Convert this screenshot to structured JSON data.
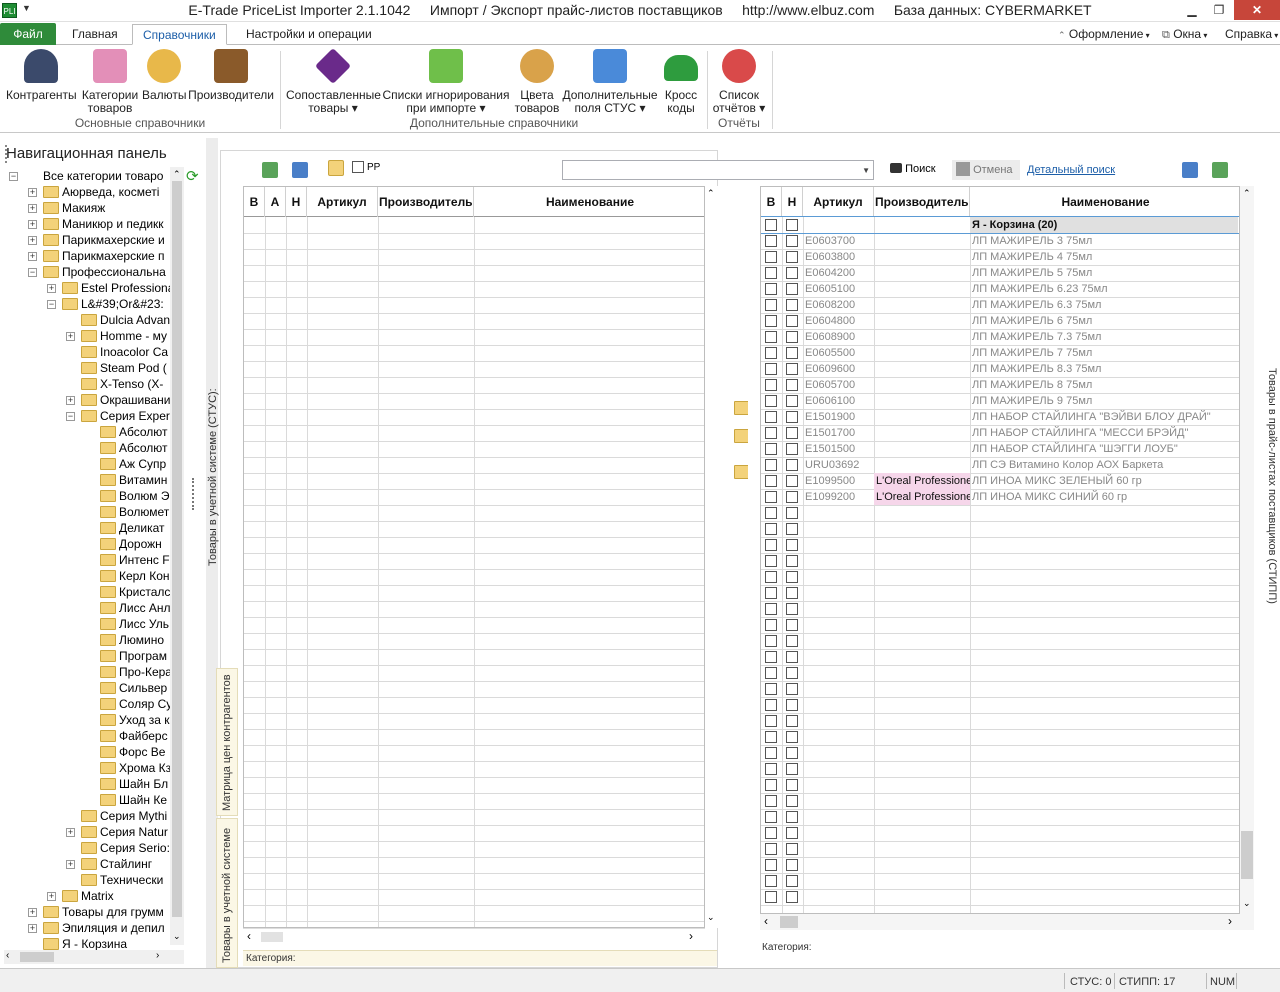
{
  "window": {
    "title": "E-Trade PriceList Importer 2.1.1042     Импорт / Экспорт прайс-листов поставщиков     http://www.elbuz.com     База данных: CYBERMARKET",
    "app_icon_text": "PLI",
    "controls": {
      "minimize": "▁",
      "maximize": "❐",
      "close": "✕"
    }
  },
  "ribbon_tabs": {
    "file": "Файл",
    "home": "Главная",
    "directories": "Справочники",
    "settings": "Настройки и операции",
    "right": {
      "design": "Оформление",
      "windows": "Окна",
      "help": "Справка"
    }
  },
  "ribbon": {
    "group1": {
      "label": "Основные справочники",
      "buttons": [
        {
          "line1": "Контрагенты",
          "line2": "",
          "icon": "contractor-icon",
          "color": "#3b4a6b"
        },
        {
          "line1": "Категории",
          "line2": "товаров",
          "icon": "categories-icon",
          "color": "#e38fb8"
        },
        {
          "line1": "Валюты",
          "line2": "",
          "icon": "currency-icon",
          "color": "#e8b84a"
        },
        {
          "line1": "Производители",
          "line2": "",
          "icon": "manufacturer-icon",
          "color": "#8a5a2a"
        }
      ]
    },
    "group2": {
      "label": "Дополнительные справочники",
      "buttons": [
        {
          "line1": "Сопоставленные",
          "line2": "товары ▾",
          "icon": "mapped-goods-icon",
          "color": "#6a2a8a"
        },
        {
          "line1": "Списки игнорирования",
          "line2": "при импорте ▾",
          "icon": "ignore-list-icon",
          "color": "#6fbf4a"
        },
        {
          "line1": "Цвета",
          "line2": "товаров",
          "icon": "colors-icon",
          "color": "#d9a24a"
        },
        {
          "line1": "Дополнительные",
          "line2": "поля СТУС ▾",
          "icon": "extra-fields-icon",
          "color": "#4a8ad9"
        },
        {
          "line1": "Кросс",
          "line2": "коды",
          "icon": "cross-codes-icon",
          "color": "#2e9c3e"
        }
      ]
    },
    "group3": {
      "label": "Отчёты",
      "buttons": [
        {
          "line1": "Список",
          "line2": "отчётов ▾",
          "icon": "reports-icon",
          "color": "#d94a4a"
        }
      ]
    }
  },
  "nav": {
    "title": "Навигационная панель",
    "tree": [
      {
        "level": 0,
        "exp": "−",
        "label": "Все категории товаро",
        "folder": false
      },
      {
        "level": 1,
        "exp": "+",
        "label": "Аюрведа, косметi"
      },
      {
        "level": 1,
        "exp": "+",
        "label": "Макияж"
      },
      {
        "level": 1,
        "exp": "+",
        "label": "Маникюр и педикк"
      },
      {
        "level": 1,
        "exp": "+",
        "label": "Парикмахерские и"
      },
      {
        "level": 1,
        "exp": "+",
        "label": "Парикмахерские п"
      },
      {
        "level": 1,
        "exp": "−",
        "label": "Профессиональна"
      },
      {
        "level": 2,
        "exp": "+",
        "label": "Estel Professiona"
      },
      {
        "level": 2,
        "exp": "−",
        "label": "L&#39;Or&#23:"
      },
      {
        "level": 3,
        "exp": "",
        "label": "Dulcia Advan"
      },
      {
        "level": 3,
        "exp": "+",
        "label": "Homme - му"
      },
      {
        "level": 3,
        "exp": "",
        "label": "Inoacolor Ca"
      },
      {
        "level": 3,
        "exp": "",
        "label": "Steam Pod ("
      },
      {
        "level": 3,
        "exp": "",
        "label": "X-Tenso (X-"
      },
      {
        "level": 3,
        "exp": "+",
        "label": "Окрашивани"
      },
      {
        "level": 3,
        "exp": "−",
        "label": "Серия Exper"
      },
      {
        "level": 4,
        "exp": "",
        "label": "Абсолют"
      },
      {
        "level": 4,
        "exp": "",
        "label": "Абсолют"
      },
      {
        "level": 4,
        "exp": "",
        "label": "Аж Супр"
      },
      {
        "level": 4,
        "exp": "",
        "label": "Витамин"
      },
      {
        "level": 4,
        "exp": "",
        "label": "Волюм Э"
      },
      {
        "level": 4,
        "exp": "",
        "label": "Волюмет"
      },
      {
        "level": 4,
        "exp": "",
        "label": "Деликат"
      },
      {
        "level": 4,
        "exp": "",
        "label": "Дорожн"
      },
      {
        "level": 4,
        "exp": "",
        "label": "Интенс F"
      },
      {
        "level": 4,
        "exp": "",
        "label": "Керл Кон"
      },
      {
        "level": 4,
        "exp": "",
        "label": "Кристалс"
      },
      {
        "level": 4,
        "exp": "",
        "label": "Лисс Анл"
      },
      {
        "level": 4,
        "exp": "",
        "label": "Лисс Уль"
      },
      {
        "level": 4,
        "exp": "",
        "label": "Люмино"
      },
      {
        "level": 4,
        "exp": "",
        "label": "Програм"
      },
      {
        "level": 4,
        "exp": "",
        "label": "Про-Кера"
      },
      {
        "level": 4,
        "exp": "",
        "label": "Сильвер"
      },
      {
        "level": 4,
        "exp": "",
        "label": "Соляр Су"
      },
      {
        "level": 4,
        "exp": "",
        "label": "Уход за к"
      },
      {
        "level": 4,
        "exp": "",
        "label": "Файберс"
      },
      {
        "level": 4,
        "exp": "",
        "label": "Форс Ве"
      },
      {
        "level": 4,
        "exp": "",
        "label": "Хрома Кз"
      },
      {
        "level": 4,
        "exp": "",
        "label": "Шайн Бл"
      },
      {
        "level": 4,
        "exp": "",
        "label": "Шайн Ке"
      },
      {
        "level": 3,
        "exp": "",
        "label": "Серия Mythi"
      },
      {
        "level": 3,
        "exp": "+",
        "label": "Серия Natur"
      },
      {
        "level": 3,
        "exp": "",
        "label": "Серия Serio:"
      },
      {
        "level": 3,
        "exp": "+",
        "label": "Стайлинг"
      },
      {
        "level": 3,
        "exp": "",
        "label": "Технически"
      },
      {
        "level": 2,
        "exp": "+",
        "label": "Matrix"
      },
      {
        "level": 1,
        "exp": "+",
        "label": "Товары для грумм"
      },
      {
        "level": 1,
        "exp": "+",
        "label": "Эпиляция и депил"
      },
      {
        "level": 1,
        "exp": "",
        "label": "Я - Корзина"
      }
    ]
  },
  "left_panel": {
    "rp_label": "РР",
    "columns": [
      "В",
      "А",
      "Н",
      "Артикул",
      "Производитель",
      "Наименование"
    ],
    "category_label": "Категория:",
    "vtab_stus": "Товары в учетной системе (СТУС):",
    "vtab_matrix": "Матрица цен контрагентов",
    "vtab_goods": "Товары в учетной системе"
  },
  "right_panel": {
    "search_value": "",
    "search_btn": "Поиск",
    "cancel_btn": "Отмена",
    "detail_link": "Детальный поиск",
    "columns": [
      "В",
      "Н",
      "Артикул",
      "Производитель",
      "Наименование"
    ],
    "group_row": "Я - Корзина (20)",
    "rows": [
      {
        "art": "E0603700",
        "mfr": "",
        "name": "ЛП МАЖИРЕЛЬ 3 75мл"
      },
      {
        "art": "E0603800",
        "mfr": "",
        "name": "ЛП МАЖИРЕЛЬ 4 75мл"
      },
      {
        "art": "E0604200",
        "mfr": "",
        "name": "ЛП МАЖИРЕЛЬ 5 75мл"
      },
      {
        "art": "E0605100",
        "mfr": "",
        "name": "ЛП МАЖИРЕЛЬ 6.23 75мл"
      },
      {
        "art": "E0608200",
        "mfr": "",
        "name": "ЛП МАЖИРЕЛЬ 6.3 75мл"
      },
      {
        "art": "E0604800",
        "mfr": "",
        "name": "ЛП МАЖИРЕЛЬ 6 75мл"
      },
      {
        "art": "E0608900",
        "mfr": "",
        "name": "ЛП МАЖИРЕЛЬ 7.3 75мл"
      },
      {
        "art": "E0605500",
        "mfr": "",
        "name": "ЛП МАЖИРЕЛЬ 7 75мл"
      },
      {
        "art": "E0609600",
        "mfr": "",
        "name": "ЛП МАЖИРЕЛЬ 8.3 75мл"
      },
      {
        "art": "E0605700",
        "mfr": "",
        "name": "ЛП МАЖИРЕЛЬ 8 75мл"
      },
      {
        "art": "E0606100",
        "mfr": "",
        "name": "ЛП МАЖИРЕЛЬ 9 75мл"
      },
      {
        "art": "E1501900",
        "mfr": "",
        "name": "ЛП НАБОР СТАЙЛИНГА \"ВЭЙВИ БЛОУ ДРАЙ\""
      },
      {
        "art": "E1501700",
        "mfr": "",
        "name": "ЛП НАБОР СТАЙЛИНГА \"МЕССИ БРЭЙД\""
      },
      {
        "art": "E1501500",
        "mfr": "",
        "name": "ЛП НАБОР СТАЙЛИНГА \"ШЭГГИ ЛОУБ\""
      },
      {
        "art": "URU03692",
        "mfr": "",
        "name": "ЛП СЭ Витамино Колор АОХ Баркета"
      },
      {
        "art": "E1099500",
        "mfr": "L'Oreal Professionel",
        "name": "ЛП ИНОА МИКС ЗЕЛЕНЫЙ 60 гр"
      },
      {
        "art": "E1099200",
        "mfr": "L'Oreal Professionel",
        "name": "ЛП ИНОА МИКС СИНИЙ 60 гр"
      }
    ],
    "category_label": "Категория:",
    "vtab": "Товары в прайс-листах поставщиков (СТИПП)"
  },
  "status": {
    "stus": "СТУС: 0",
    "stipp": "СТИПП: 17",
    "num": "NUM"
  },
  "colors": {
    "file_tab": "#2f8b3a",
    "accent": "#1c5ea8",
    "mfr_highlight": "#f6d6ea",
    "group_row": "#e0e0e0"
  }
}
